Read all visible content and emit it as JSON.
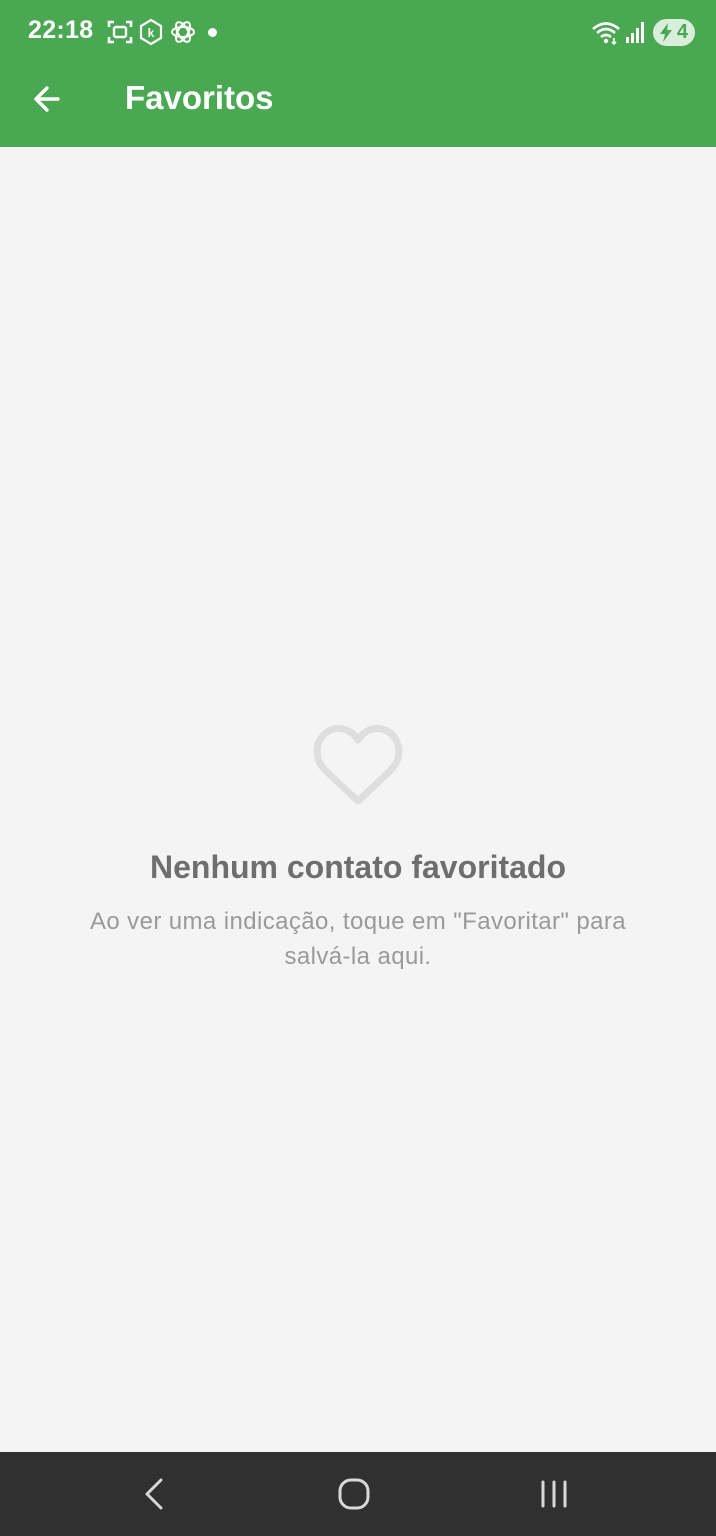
{
  "status_bar": {
    "time": "22:18",
    "battery_level": "4",
    "icons": [
      "screenshot-icon",
      "kaspersky-icon",
      "chatgpt-icon",
      "notification-dot",
      "wifi-icon",
      "signal-icon",
      "battery-charging-icon"
    ]
  },
  "app_bar": {
    "title": "Favoritos",
    "back_icon": "arrow-left-icon"
  },
  "empty_state": {
    "icon": "heart-outline-icon",
    "title": "Nenhum contato favoritado",
    "description": "Ao ver uma indicação, toque em \"Favoritar\" para salvá-la aqui."
  },
  "nav_bar": {
    "buttons": [
      "back-icon",
      "home-icon",
      "recents-icon"
    ]
  },
  "colors": {
    "primary": "#4aa853",
    "background": "#f4f4f4",
    "nav_bar": "#303030",
    "empty_title": "#6e6e6e",
    "empty_text": "#9a9a9a"
  }
}
